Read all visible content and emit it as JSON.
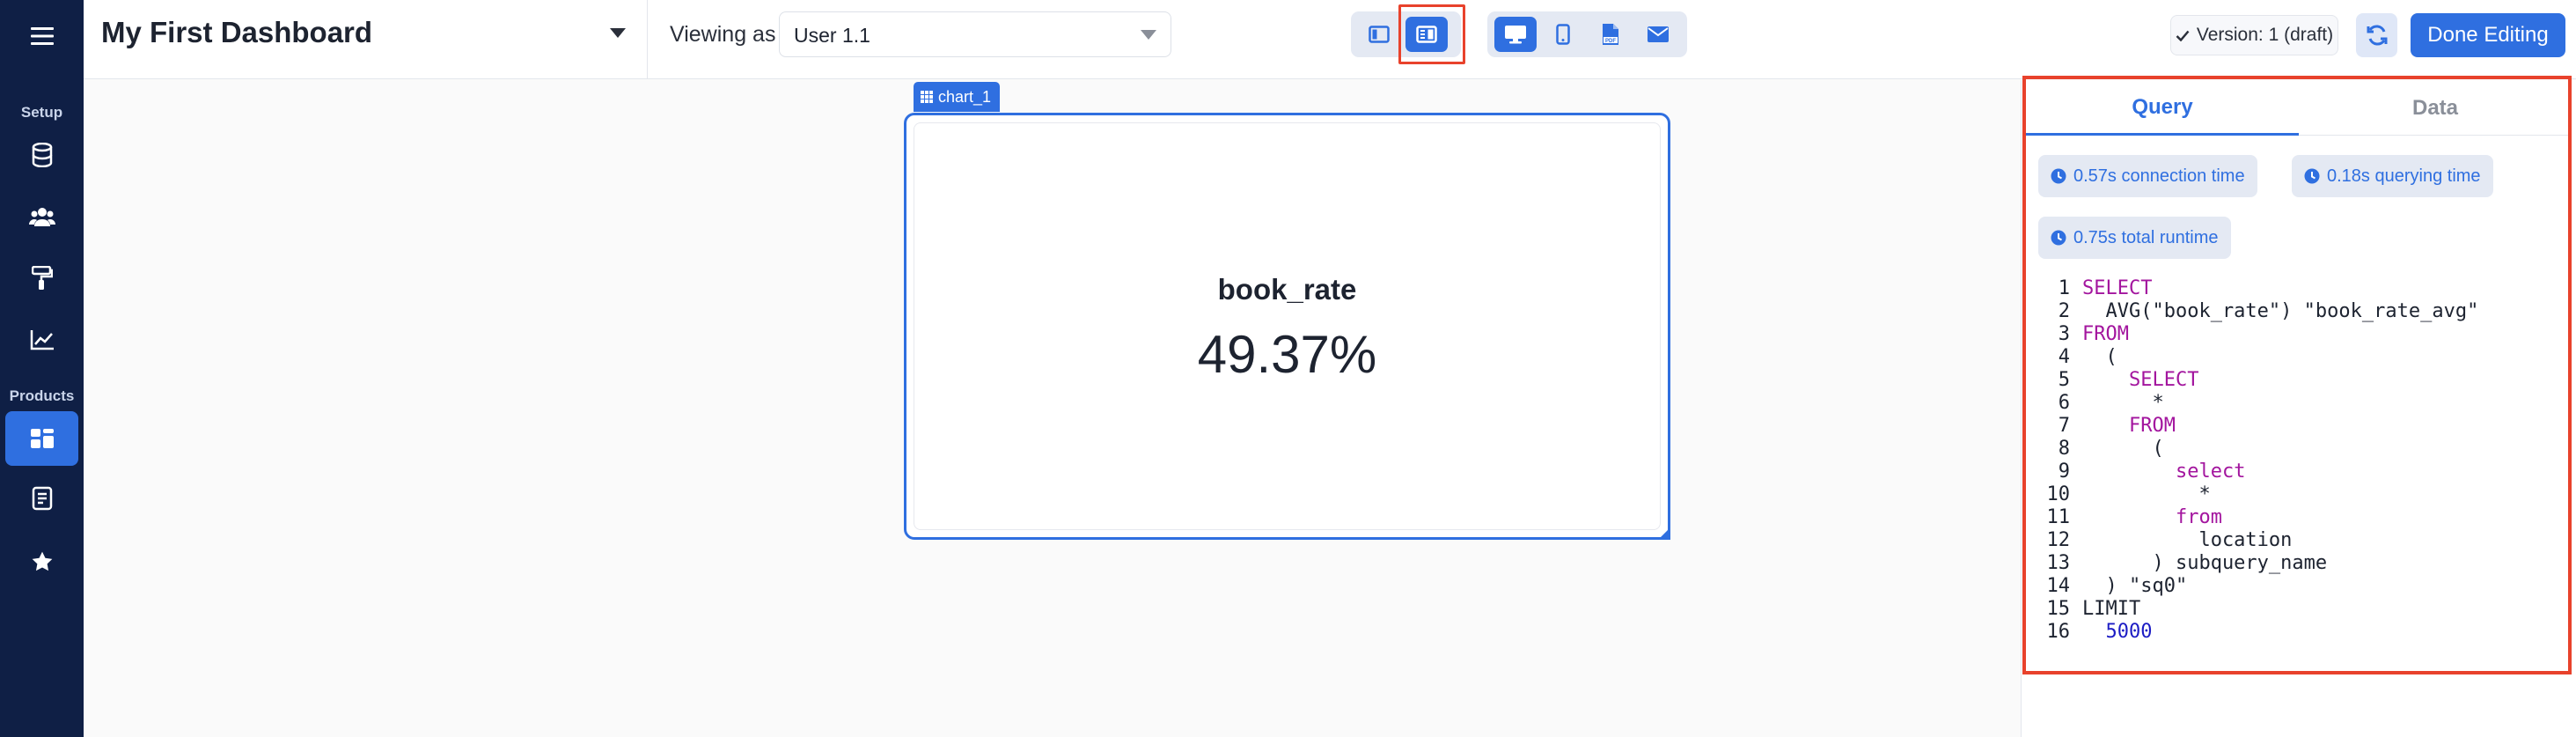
{
  "sidebar": {
    "sections": {
      "setup": "Setup",
      "products": "Products"
    },
    "items": [
      {
        "name": "sidebar-item-menu",
        "icon": "hamburger-icon"
      },
      {
        "name": "sidebar-item-database",
        "icon": "database-icon"
      },
      {
        "name": "sidebar-item-users",
        "icon": "users-icon"
      },
      {
        "name": "sidebar-item-theme",
        "icon": "paint-roller-icon"
      },
      {
        "name": "sidebar-item-analytics",
        "icon": "line-chart-icon"
      },
      {
        "name": "sidebar-item-dashboards",
        "icon": "dashboard-icon",
        "active": true
      },
      {
        "name": "sidebar-item-reports",
        "icon": "report-icon"
      },
      {
        "name": "sidebar-item-favorites",
        "icon": "star-icon"
      }
    ]
  },
  "header": {
    "title": "My First Dashboard",
    "viewing_label": "Viewing as",
    "viewing_value": "User 1.1",
    "version": "Version: 1 (draft)",
    "done_label": "Done Editing"
  },
  "chart": {
    "tag": "chart_1",
    "label": "book_rate",
    "value": "49.37%"
  },
  "panel": {
    "tabs": {
      "query": "Query",
      "data": "Data"
    },
    "active_tab": "Query",
    "timings": {
      "connection": "0.57s connection time",
      "querying": "0.18s querying time",
      "total": "0.75s total runtime"
    },
    "code_lines": [
      "SELECT",
      "  AVG(\"book_rate\") \"book_rate_avg\"",
      "FROM",
      "  (",
      "    SELECT",
      "      *",
      "    FROM",
      "      (",
      "        select",
      "          *",
      "        from",
      "          location",
      "      ) subquery_name",
      "  ) \"sq0\"",
      "LIMIT",
      "  5000"
    ]
  },
  "colors": {
    "accent": "#2f6fe0",
    "sidebar": "#0f1f45",
    "highlight": "#e8422c",
    "keyword": "#a3159e"
  }
}
